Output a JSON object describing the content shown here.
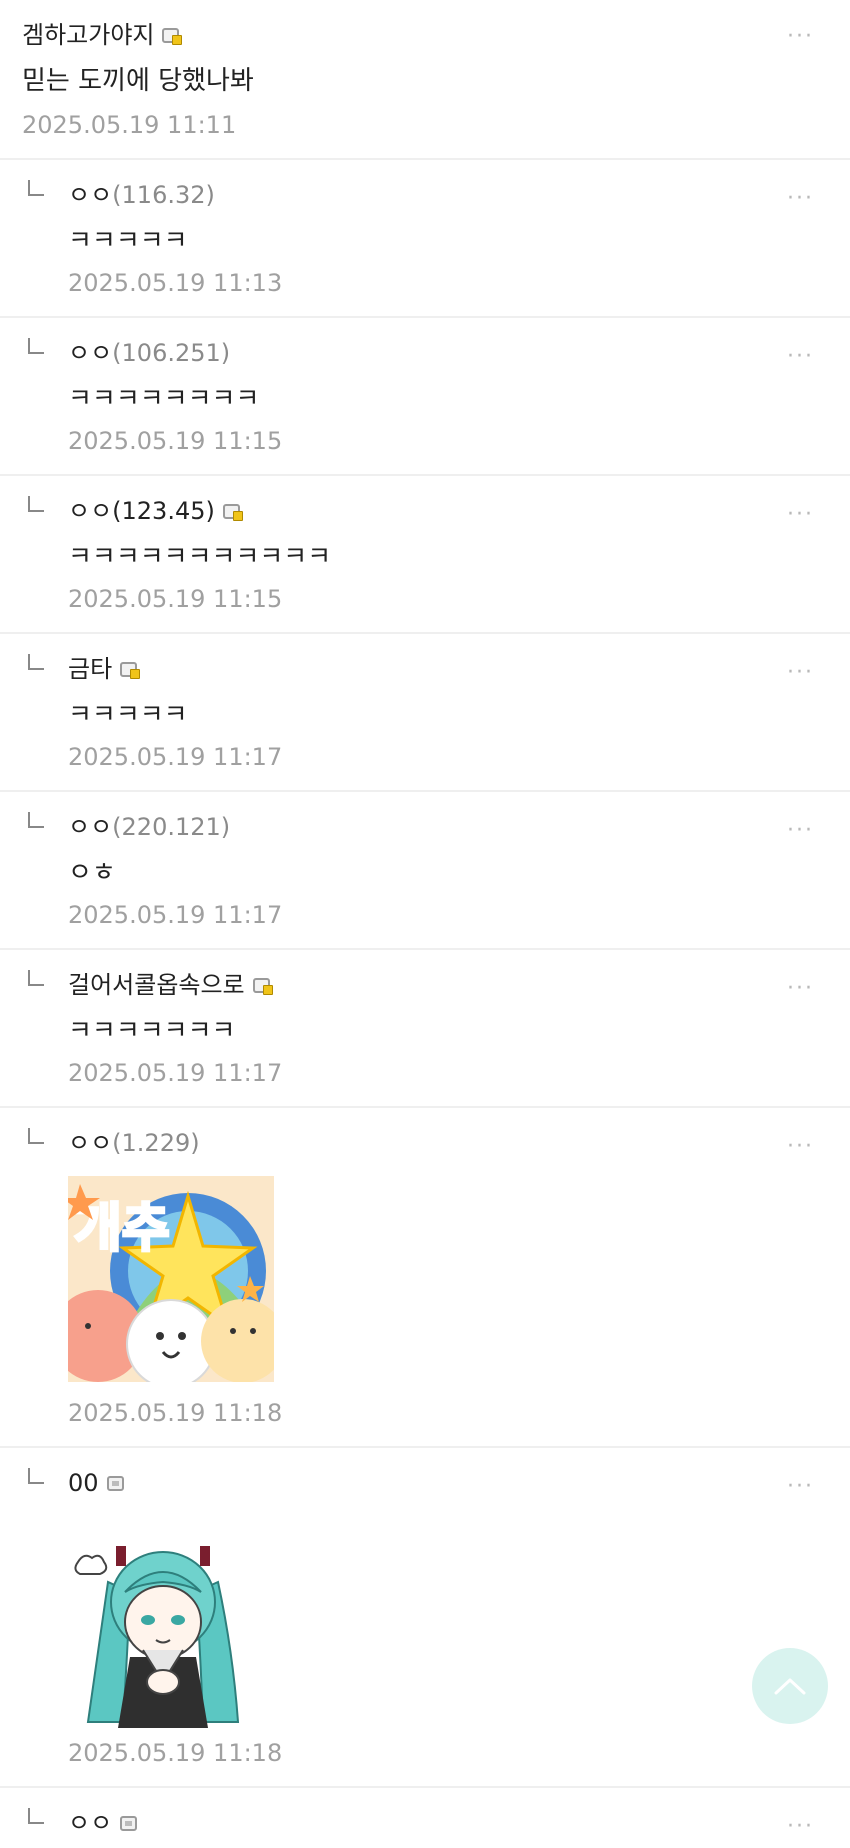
{
  "comments": [
    {
      "nickname": "겜하고가야지",
      "text": "믿는 도끼에 당했나봐",
      "date": "2025.05.19 11:11"
    },
    {
      "nickname": "ㅇㅇ",
      "ip": "(116.32)",
      "text": "ㅋㅋㅋㅋㅋ",
      "date": "2025.05.19 11:13"
    },
    {
      "nickname": "ㅇㅇ",
      "ip": "(106.251)",
      "text": "ㅋㅋㅋㅋㅋㅋㅋㅋ",
      "date": "2025.05.19 11:15"
    },
    {
      "nickname": "ㅇㅇ(123.45)",
      "text": "ㅋㅋㅋㅋㅋㅋㅋㅋㅋㅋㅋ",
      "date": "2025.05.19 11:15"
    },
    {
      "nickname": "금타",
      "text": "ㅋㅋㅋㅋㅋ",
      "date": "2025.05.19 11:17"
    },
    {
      "nickname": "ㅇㅇ",
      "ip": "(220.121)",
      "text": "ㅇㅎ",
      "date": "2025.05.19 11:17"
    },
    {
      "nickname": "걸어서콜옵속으로",
      "text": "ㅋㅋㅋㅋㅋㅋㅋ",
      "date": "2025.05.19 11:17"
    },
    {
      "nickname": "ㅇㅇ",
      "ip": "(1.229)",
      "sticker_text": "개추",
      "date": "2025.05.19 11:18"
    },
    {
      "nickname": "00",
      "date": "2025.05.19 11:18"
    },
    {
      "nickname": "ㅇㅇ"
    }
  ],
  "more_label": "···",
  "icons": {
    "reply": "reply-arrow-icon",
    "more": "more-dots-icon",
    "badge": "fixed-nick-badge-icon",
    "scroll_top": "chevron-up-icon"
  },
  "colors": {
    "date": "#a0a0a0",
    "ip": "#8a8a8a",
    "fab": "#d9f3ef",
    "badge_gold": "#f0c419"
  }
}
